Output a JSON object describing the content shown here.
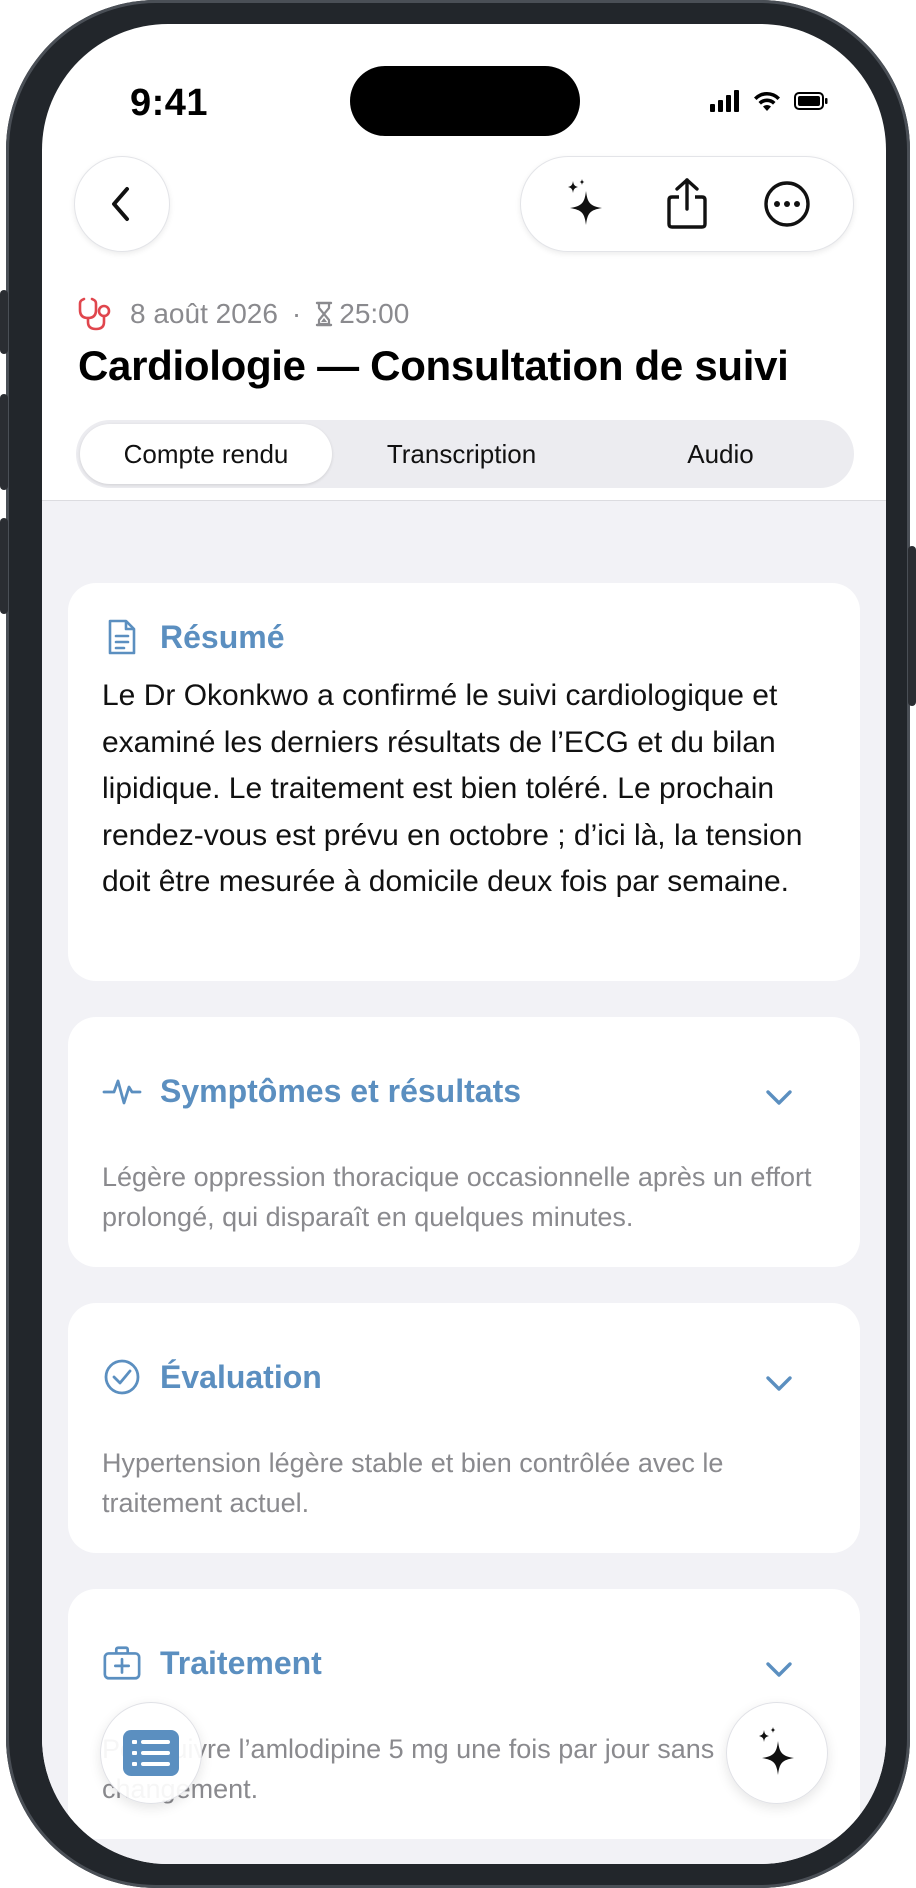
{
  "status": {
    "time": "9:41"
  },
  "nav": {
    "back_icon": "chevron-left-icon",
    "actions": [
      "sparkles-icon",
      "share-icon",
      "more-icon"
    ]
  },
  "header": {
    "date": "8 août 2026",
    "separator": "·",
    "duration": "25:00",
    "title": "Cardiologie — Consultation de suivi",
    "accent_color": "#e0464d"
  },
  "tabs": [
    {
      "label": "Compte rendu",
      "active": true
    },
    {
      "label": "Transcription",
      "active": false
    },
    {
      "label": "Audio",
      "active": false
    }
  ],
  "summary": {
    "heading": "Résumé",
    "text": "Le Dr Okonkwo a confirmé le suivi cardiologique et examiné les derniers résultats de l’ECG et du bilan lipidique. Le traitement est bien toléré. Le prochain rendez-vous est prévu en octobre ; d’ici là, la tension doit être mesurée à domicile deux fois par semaine."
  },
  "sections": [
    {
      "heading": "Symptômes et résultats",
      "icon": "heartbeat-icon",
      "text": "Légère oppression thoracique occasionnelle après un effort prolongé, qui disparaît en quelques minutes."
    },
    {
      "heading": "Évaluation",
      "icon": "check-circle-icon",
      "text": "Hypertension légère stable et bien contrôlée avec le traitement actuel."
    },
    {
      "heading": "Traitement",
      "icon": "medical-kit-icon",
      "text": "Poursuivre l’amlodipine 5 mg une fois par jour sans changement."
    }
  ],
  "colors": {
    "accent": "#5b8fc0",
    "background": "#f2f2f6"
  },
  "fabs": [
    "list-icon",
    "sparkles-icon"
  ]
}
